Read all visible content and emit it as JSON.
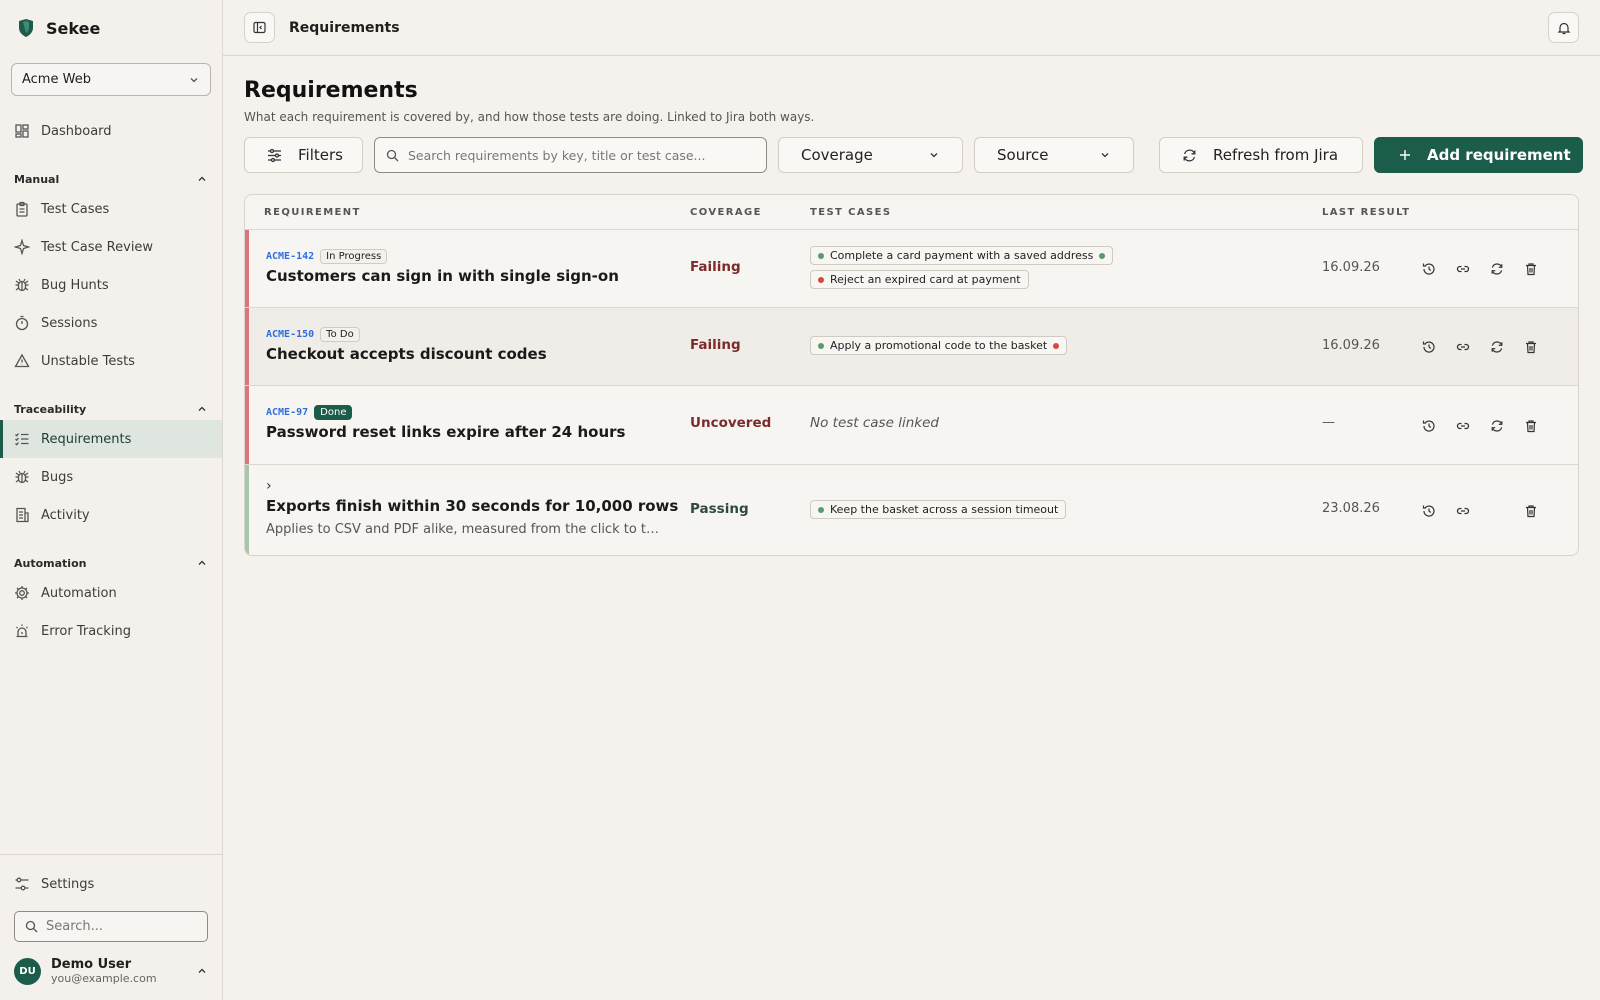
{
  "brand": {
    "name": "Sekee",
    "accent": "#1c5c4b"
  },
  "project_select": {
    "value": "Acme Web"
  },
  "nav": {
    "dashboard": "Dashboard",
    "manual": {
      "title": "Manual",
      "items": [
        "Test Cases",
        "Test Case Review",
        "Bug Hunts",
        "Sessions",
        "Unstable Tests"
      ]
    },
    "traceability": {
      "title": "Traceability",
      "items": [
        "Requirements",
        "Bugs",
        "Activity"
      ]
    },
    "automation": {
      "title": "Automation",
      "items": [
        "Automation",
        "Error Tracking"
      ]
    },
    "settings": "Settings",
    "search_placeholder": "Search..."
  },
  "user": {
    "initials": "DU",
    "name": "Demo User",
    "email": "you@example.com"
  },
  "topbar": {
    "title": "Requirements"
  },
  "page": {
    "title": "Requirements",
    "subtitle": "What each requirement is covered by, and how those tests are doing. Linked to Jira both ways."
  },
  "toolbar": {
    "filters": "Filters",
    "search_placeholder": "Search requirements by key, title or test case...",
    "coverage": "Coverage",
    "source": "Source",
    "refresh": "Refresh from Jira",
    "add": "Add requirement"
  },
  "table": {
    "headers": {
      "requirement": "REQUIREMENT",
      "coverage": "COVERAGE",
      "test_cases": "TEST CASES",
      "last_result": "LAST RESULT"
    },
    "rows": [
      {
        "key": "ACME-142",
        "status": "In Progress",
        "title": "Customers can sign in with single sign-on",
        "coverage": "Failing",
        "test_cases": [
          "Complete a card payment with a saved address",
          "Reject an expired card at payment"
        ],
        "last_result": "16.09.26",
        "bar_color": "#d9787a"
      },
      {
        "key": "ACME-150",
        "status": "To Do",
        "title": "Checkout accepts discount codes",
        "coverage": "Failing",
        "test_cases": [
          "Apply a promotional code to the basket"
        ],
        "last_result": "16.09.26",
        "bar_color": "#d9787a"
      },
      {
        "key": "ACME-97",
        "status": "Done",
        "title": "Password reset links expire after 24 hours",
        "coverage": "Uncovered",
        "test_cases_empty": "No test case linked",
        "last_result": "—",
        "bar_color": "#d9787a"
      },
      {
        "expand": "›",
        "title": "Exports finish within 30 seconds for 10,000 rows",
        "description": "Applies to CSV and PDF alike, measured from the click to the download starting.",
        "coverage": "Passing",
        "test_cases": [
          "Keep the basket across a session timeout"
        ],
        "last_result": "23.08.26",
        "bar_color": "#a6c6a8"
      }
    ]
  }
}
